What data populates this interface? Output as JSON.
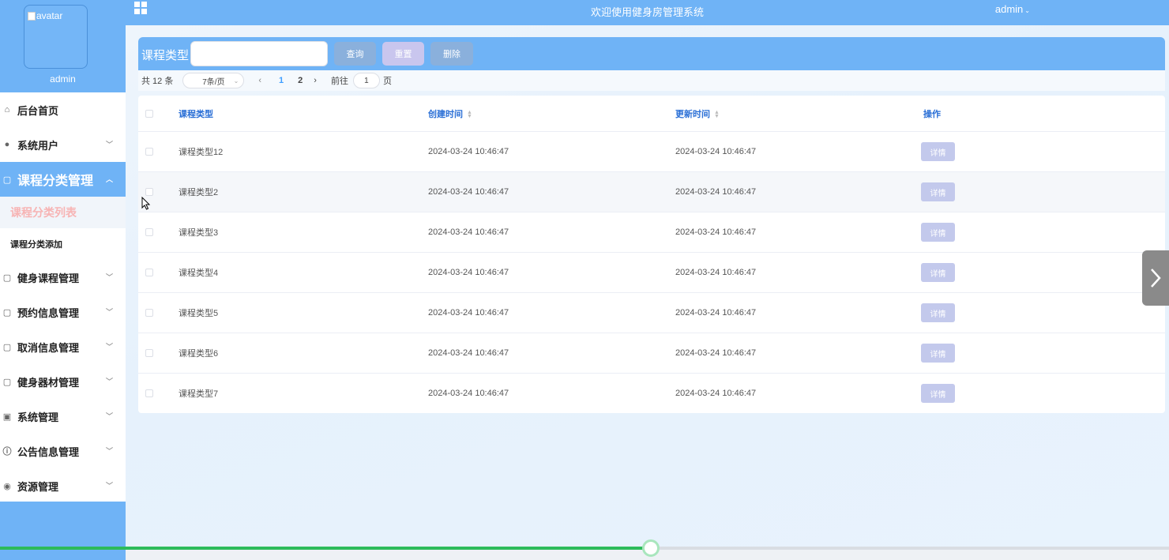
{
  "sidebar": {
    "avatar_alt": "avatar",
    "username": "admin",
    "items": [
      {
        "label": "后台首页",
        "icon": "home-icon"
      },
      {
        "label": "系统用户",
        "icon": "user-icon"
      },
      {
        "label": "课程分类管理",
        "icon": "doc-icon",
        "active": true,
        "sub": [
          {
            "label": "课程分类列表",
            "current": true
          },
          {
            "label": "课程分类添加"
          }
        ]
      },
      {
        "label": "健身课程管理",
        "icon": "doc-icon"
      },
      {
        "label": "预约信息管理",
        "icon": "doc-icon"
      },
      {
        "label": "取消信息管理",
        "icon": "doc-icon"
      },
      {
        "label": "健身器材管理",
        "icon": "doc-icon"
      },
      {
        "label": "系统管理",
        "icon": "picture-icon"
      },
      {
        "label": "公告信息管理",
        "icon": "info-icon"
      },
      {
        "label": "资源管理",
        "icon": "location-icon"
      }
    ]
  },
  "header": {
    "title": "欢迎使用健身房管理系统",
    "user": "admin"
  },
  "search": {
    "label": "课程类型",
    "value": "",
    "query_label": "查询",
    "reset_label": "重置",
    "delete_label": "删除"
  },
  "pagination": {
    "total": "共 12 条",
    "page_size": "7条/页",
    "pages": [
      "1",
      "2"
    ],
    "current_page": "1",
    "goto_label": "前往",
    "goto_value": "1",
    "page_suffix": "页"
  },
  "table": {
    "columns": [
      "课程类型",
      "创建时间",
      "更新时间",
      "操作"
    ],
    "detail_label": "详情",
    "rows": [
      {
        "name": "课程类型12",
        "created": "2024-03-24 10:46:47",
        "updated": "2024-03-24 10:46:47"
      },
      {
        "name": "课程类型2",
        "created": "2024-03-24 10:46:47",
        "updated": "2024-03-24 10:46:47"
      },
      {
        "name": "课程类型3",
        "created": "2024-03-24 10:46:47",
        "updated": "2024-03-24 10:46:47"
      },
      {
        "name": "课程类型4",
        "created": "2024-03-24 10:46:47",
        "updated": "2024-03-24 10:46:47"
      },
      {
        "name": "课程类型5",
        "created": "2024-03-24 10:46:47",
        "updated": "2024-03-24 10:46:47"
      },
      {
        "name": "课程类型6",
        "created": "2024-03-24 10:46:47",
        "updated": "2024-03-24 10:46:47"
      },
      {
        "name": "课程类型7",
        "created": "2024-03-24 10:46:47",
        "updated": "2024-03-24 10:46:47"
      }
    ]
  },
  "video_progress": 0.557,
  "colors": {
    "accent": "#6fb3f6",
    "progress": "#2dbb5a",
    "link": "#2a6fd6"
  }
}
